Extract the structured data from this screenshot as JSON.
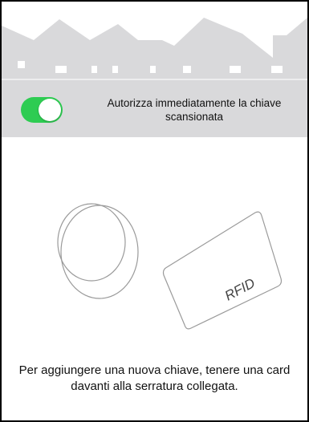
{
  "colors": {
    "header_bg": "#d9d9db",
    "skyline": "#ffffff",
    "toggle_on": "#2ecc52",
    "line_art": "#9a9a9a"
  },
  "toggle": {
    "label": "Autorizza immediatamente la chiave scansionata",
    "state": "on"
  },
  "illustration": {
    "card_text": "RFID",
    "fob_icon": "key-fob-icon",
    "card_icon": "rfid-card-icon"
  },
  "instructions": {
    "text": "Per aggiungere una nuova chiave, tenere una card davanti alla serratura collegata."
  }
}
